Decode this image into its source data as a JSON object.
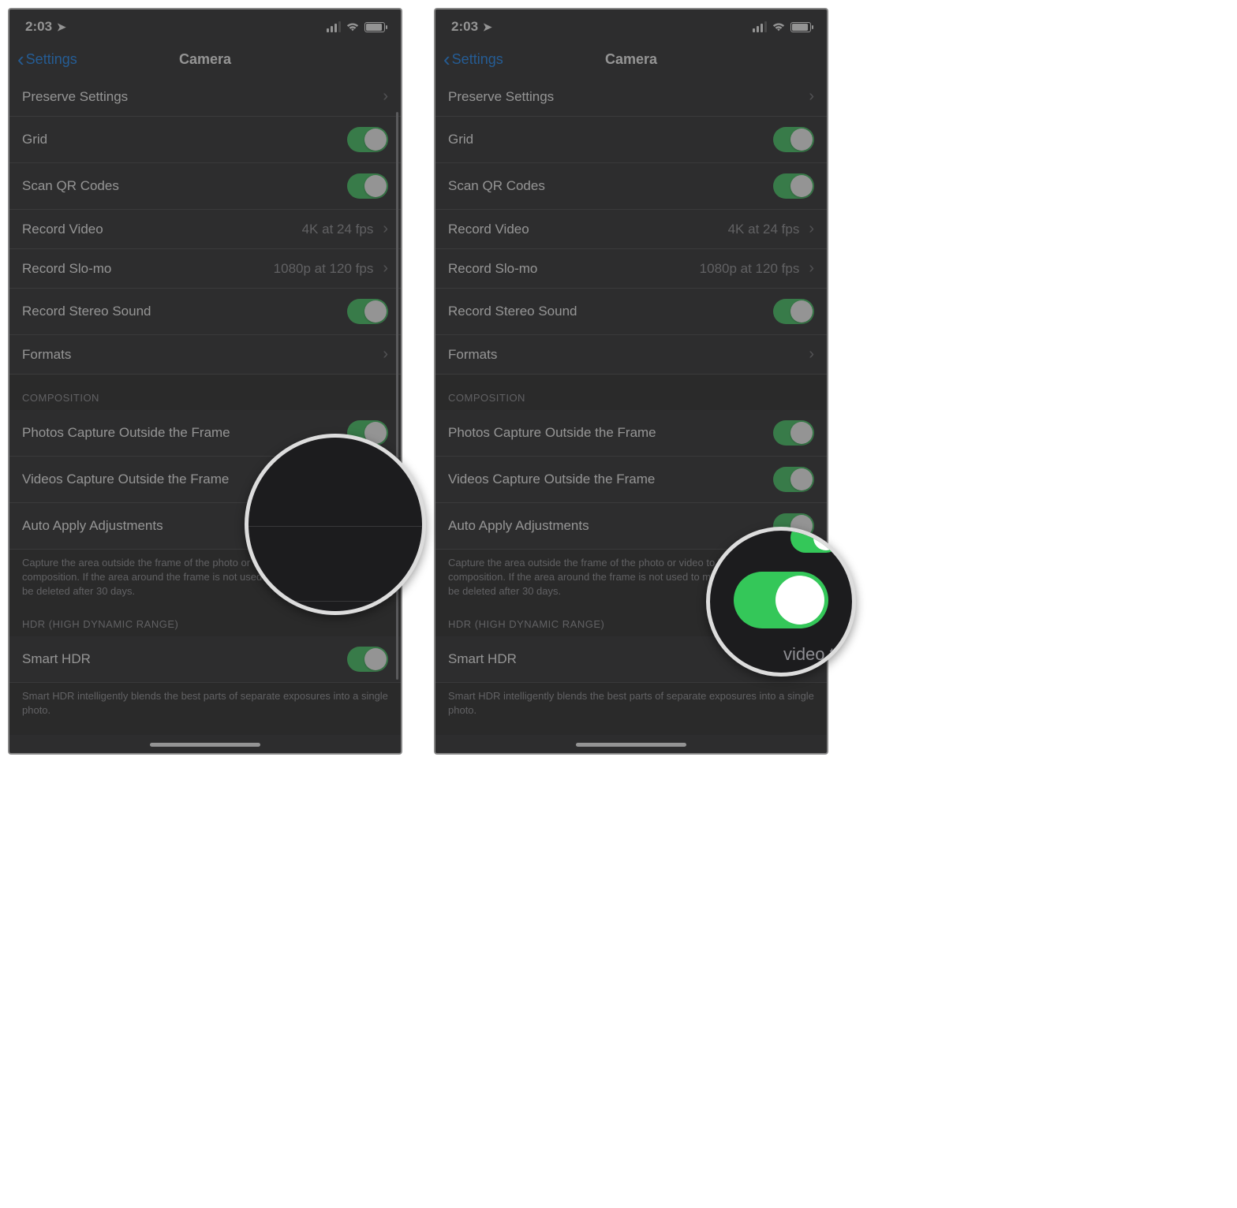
{
  "status": {
    "time": "2:03",
    "location_icon": "location-arrow-icon"
  },
  "nav": {
    "back_label": "Settings",
    "title": "Camera"
  },
  "rows": {
    "preserve": "Preserve Settings",
    "grid": "Grid",
    "scanqr": "Scan QR Codes",
    "record_video": "Record Video",
    "record_video_val": "4K at 24 fps",
    "record_slomo": "Record Slo-mo",
    "record_slomo_val": "1080p at 120 fps",
    "stereo": "Record Stereo Sound",
    "formats": "Formats",
    "photos_outside": "Photos Capture Outside the Frame",
    "videos_outside": "Videos Capture Outside the Frame",
    "auto_apply": "Auto Apply Adjustments",
    "smart_hdr": "Smart HDR"
  },
  "sections": {
    "composition": "COMPOSITION",
    "composition_footer": "Capture the area outside the frame of the photo or video to improve composition. If the area around the frame is not used to make corrections, it will be deleted after 30 days.",
    "hdr": "HDR (HIGH DYNAMIC RANGE)",
    "hdr_footer": "Smart HDR intelligently blends the best parts of separate exposures into a single photo."
  },
  "mag2_text": "video to"
}
